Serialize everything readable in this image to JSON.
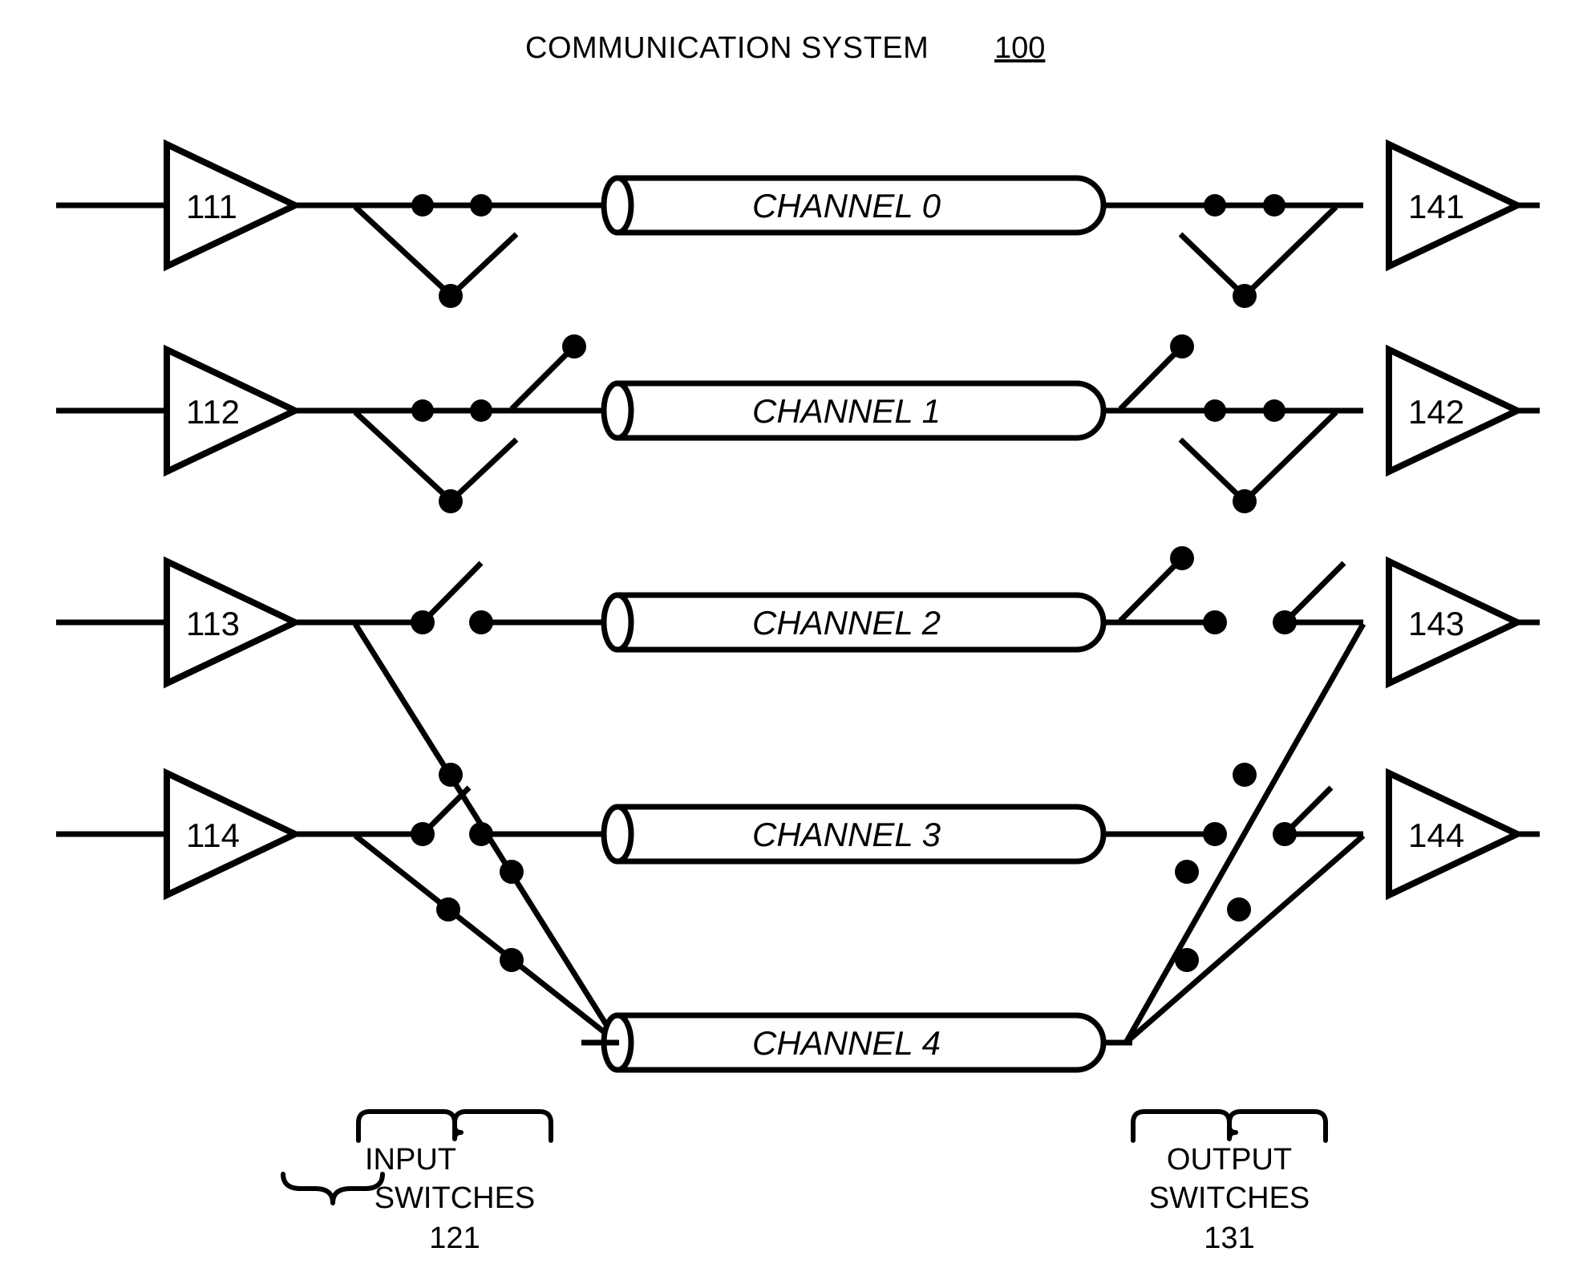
{
  "figure": {
    "title_text": "COMMUNICATION SYSTEM",
    "title_ref": "100"
  },
  "input_amplifiers": [
    {
      "label": "111"
    },
    {
      "label": "112"
    },
    {
      "label": "113"
    },
    {
      "label": "114"
    }
  ],
  "output_amplifiers": [
    {
      "label": "141"
    },
    {
      "label": "142"
    },
    {
      "label": "143"
    },
    {
      "label": "144"
    }
  ],
  "channels": [
    {
      "label": "CHANNEL 0"
    },
    {
      "label": "CHANNEL 1"
    },
    {
      "label": "CHANNEL 2"
    },
    {
      "label": "CHANNEL 3"
    },
    {
      "label": "CHANNEL 4"
    }
  ],
  "groups": {
    "input_switches": {
      "line1": "INPUT",
      "line2": "SWITCHES",
      "ref": "121"
    },
    "output_switches": {
      "line1": "OUTPUT",
      "line2": "SWITCHES",
      "ref": "131"
    }
  },
  "colors": {
    "ink": "#000000",
    "paper": "#ffffff"
  },
  "chart_data": {
    "type": "diagram",
    "title": "COMMUNICATION SYSTEM 100",
    "description": "Patent block diagram of a communication system with four input amplifiers feeding a bank of input switches, five channels, a bank of output switches, and four output amplifiers.",
    "input_amplifiers": [
      "111",
      "112",
      "113",
      "114"
    ],
    "output_amplifiers": [
      "141",
      "142",
      "143",
      "144"
    ],
    "channels": [
      "CHANNEL 0",
      "CHANNEL 1",
      "CHANNEL 2",
      "CHANNEL 3",
      "CHANNEL 4"
    ],
    "switch_banks": [
      "INPUT SWITCHES 121",
      "OUTPUT SWITCHES 131"
    ]
  }
}
